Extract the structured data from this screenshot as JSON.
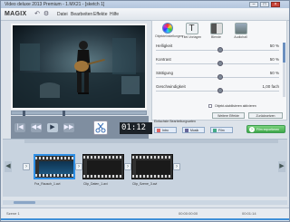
{
  "window": {
    "title": "Video deluxe 2013 Premium - 1.MX21 - [sketch 1]",
    "controls": [
      "–",
      "□",
      "×"
    ]
  },
  "menubar": {
    "logo": "MAGIX",
    "logo_dot": "",
    "menus": [
      "Datei",
      "Bearbeiten",
      "Effekte",
      "Hilfe"
    ]
  },
  "preview": {
    "scene_alt": "Frau mit Gitarre"
  },
  "transport": {
    "labels": [
      "|◀",
      "◀◀",
      "▶",
      "▶▶"
    ],
    "timecode": "01:12"
  },
  "effects_panel": {
    "tools": [
      {
        "label": "Objekteinstellungen",
        "icon": "color-wheel-icon"
      },
      {
        "label": "Titel-Vorlagen",
        "icon": "text-icon"
      },
      {
        "label": "Blende",
        "icon": "transition-icon"
      },
      {
        "label": "Audiohall",
        "icon": "audio-icon"
      }
    ],
    "params": [
      {
        "name": "Helligkeit",
        "value": "50 %",
        "level": 0.5
      },
      {
        "name": "Kontrast",
        "value": "50 %",
        "level": 0.5
      },
      {
        "name": "Sättigung",
        "value": "50 %",
        "level": 0.5
      },
      {
        "name": "Geschwindigkeit",
        "value": "1,00 fach",
        "level": 0.5
      }
    ],
    "checkbox_label": "Objekt-stabilisieren aktivieren",
    "buttons": [
      "Weitere Effekte",
      "Zurücksetzen"
    ]
  },
  "media_pool": {
    "label": "Einfachste Bearbeitungsarten",
    "buttons": [
      "Intro",
      "Musik",
      "Film"
    ],
    "export_label": "Film exportieren"
  },
  "storyboard": {
    "clips": [
      {
        "name": "Fra_Rausch_1.avi",
        "selected": true
      },
      {
        "name": "Clip_Daten_1.avi",
        "selected": false
      },
      {
        "name": "Clip_Szene_3.avi",
        "selected": false
      }
    ],
    "nav": [
      "◀",
      "▶"
    ]
  },
  "statusbar": {
    "left": "Szene 1",
    "middle": "00:00:00:00",
    "right": "00:01:14"
  },
  "colors": {
    "accent": "#3e8fd8",
    "export": "#3fa84b",
    "logo": "#e22222"
  }
}
